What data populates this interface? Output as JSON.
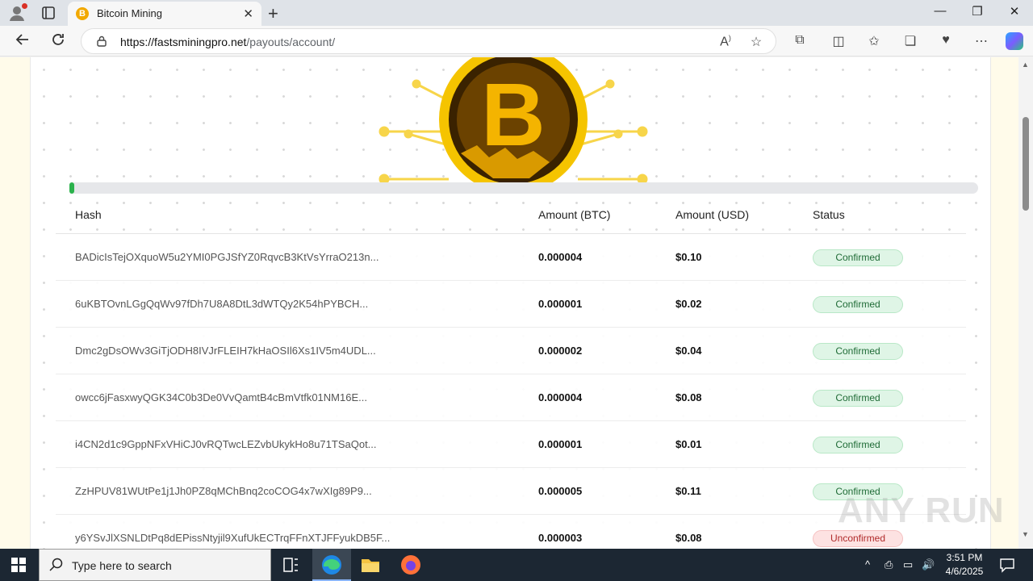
{
  "browser": {
    "tab_title": "Bitcoin Mining",
    "tab_close": "✕",
    "new_tab": "+",
    "url_domain": "https://fastsminingpro.net",
    "url_path": "/payouts/account/",
    "window": {
      "minimize": "—",
      "restore": "❐",
      "close": "✕"
    }
  },
  "page": {
    "hero_symbol": "B",
    "progress_percent": 0.5,
    "table": {
      "headers": [
        "Hash",
        "Amount (BTC)",
        "Amount (USD)",
        "Status"
      ],
      "rows": [
        {
          "hash": "BADicIsTejOXquoW5u2YMI0PGJSfYZ0RqvcB3KtVsYrraO213n...",
          "btc": "0.000004",
          "usd": "$0.10",
          "status": "Confirmed"
        },
        {
          "hash": "6uKBTOvnLGgQqWv97fDh7U8A8DtL3dWTQy2K54hPYBCH...",
          "btc": "0.000001",
          "usd": "$0.02",
          "status": "Confirmed"
        },
        {
          "hash": "Dmc2gDsOWv3GiTjODH8IVJrFLEIH7kHaOSIl6Xs1IV5m4UDL...",
          "btc": "0.000002",
          "usd": "$0.04",
          "status": "Confirmed"
        },
        {
          "hash": "owcc6jFasxwyQGK34C0b3De0VvQamtB4cBmVtfk01NM16E...",
          "btc": "0.000004",
          "usd": "$0.08",
          "status": "Confirmed"
        },
        {
          "hash": "i4CN2d1c9GppNFxVHiCJ0vRQTwcLEZvbUkykHo8u71TSaQot...",
          "btc": "0.000001",
          "usd": "$0.01",
          "status": "Confirmed"
        },
        {
          "hash": "ZzHPUV81WUtPe1j1Jh0PZ8qMChBnq2coCOG4x7wXIg89P9...",
          "btc": "0.000005",
          "usd": "$0.11",
          "status": "Confirmed"
        },
        {
          "hash": "y6YSvJlXSNLDtPq8dEPissNtyjil9XufUkECTrqFFnXTJFFyukDB5F...",
          "btc": "0.000003",
          "usd": "$0.08",
          "status": "Unconfirmed"
        }
      ]
    }
  },
  "watermark": "ANY RUN",
  "taskbar": {
    "search_placeholder": "Type here to search",
    "time": "3:51 PM",
    "date": "4/6/2025"
  },
  "colors": {
    "accent_green": "#2bb24c",
    "confirmed_bg": "#dff5e6",
    "unconfirmed_bg": "#fde2e2",
    "bitcoin_gold": "#f2a900"
  },
  "icons": [
    "profile-icon",
    "tabs-icon",
    "back-icon",
    "refresh-icon",
    "lock-icon",
    "read-aloud-icon",
    "favorite-star-icon",
    "extensions-icon",
    "split-screen-icon",
    "favorites-icon",
    "collections-icon",
    "performance-icon",
    "more-icon",
    "copilot-icon",
    "windows-start-icon",
    "search-icon",
    "task-view-icon",
    "edge-icon",
    "file-explorer-icon",
    "firefox-icon",
    "notification-icon"
  ]
}
